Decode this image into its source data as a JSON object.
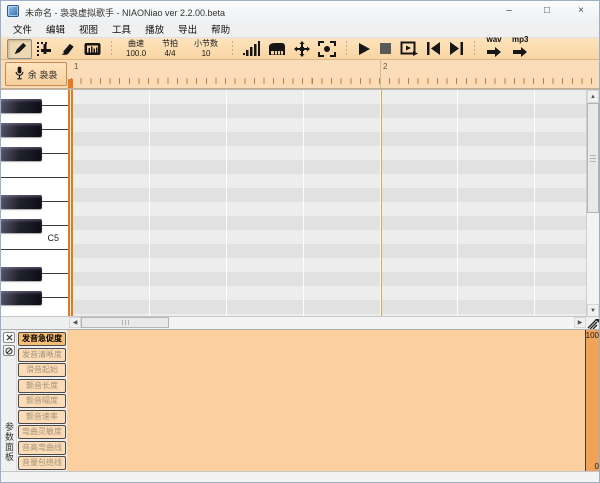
{
  "window": {
    "title": "未命名 - 袅袅虚拟歌手 - NIAONiao ver 2.2.00.beta",
    "minimize_glyph": "–",
    "maximize_glyph": "□",
    "close_glyph": "×"
  },
  "menu": {
    "items": [
      "文件",
      "编辑",
      "视图",
      "工具",
      "播放",
      "导出",
      "帮助"
    ]
  },
  "toolbar": {
    "tempo_label": "曲速",
    "tempo_value": "100.0",
    "beat_label": "节拍",
    "beat_value": "4/4",
    "measures_label": "小节数",
    "measures_value": "10",
    "wav_label": "wav",
    "mp3_label": "mp3"
  },
  "track": {
    "singer": "余 袅袅"
  },
  "ruler": {
    "measure_1": "1",
    "measure_2": "2"
  },
  "piano": {
    "c5_label": "C5"
  },
  "params": {
    "side_tab": "参数面板",
    "scale_max": "100",
    "scale_min": "0",
    "buttons": [
      {
        "label": "发音急促度",
        "active": true
      },
      {
        "label": "发音清晰度",
        "active": false
      },
      {
        "label": "滑音起始",
        "active": false
      },
      {
        "label": "颤音长度",
        "active": false
      },
      {
        "label": "颤音幅度",
        "active": false
      },
      {
        "label": "颤音速率",
        "active": false
      },
      {
        "label": "弯曲灵敏度",
        "active": false
      },
      {
        "label": "音高弯曲线",
        "active": false
      },
      {
        "label": "音量包络线",
        "active": false
      }
    ]
  },
  "icons": {
    "up": "▲",
    "down": "▼",
    "left": "◀",
    "right": "▶"
  },
  "colors": {
    "accent_orange": "#e87820",
    "toolbar_peach": "#fbdcb6",
    "panel_canvas": "#fbcf9e",
    "scale_strip": "#f2a159",
    "grid_row_light": "#ededed",
    "grid_row_dark": "#e1e1e1"
  }
}
